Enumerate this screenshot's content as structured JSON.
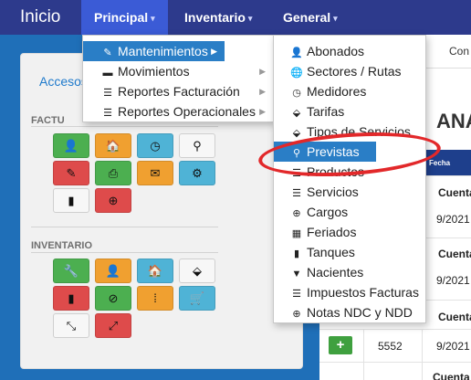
{
  "navbar": {
    "brand": "Inicio",
    "items": [
      {
        "label": "Principal",
        "active": true
      },
      {
        "label": "Inventario",
        "active": false
      },
      {
        "label": "General",
        "active": false
      }
    ],
    "caret": "▾"
  },
  "left_panel": {
    "link": "Accesos",
    "section1": "FACTU",
    "section2": "INVENTARIO",
    "tiles1": [
      {
        "icon": "user-icon",
        "glyph": "👤",
        "color": "green"
      },
      {
        "icon": "home-icon",
        "glyph": "🏠",
        "color": "orange"
      },
      {
        "icon": "clock-icon",
        "glyph": "◷",
        "color": "blue"
      },
      {
        "icon": "map-marker-icon",
        "glyph": "⚲",
        "color": "white"
      },
      {
        "icon": "pencil-icon",
        "glyph": "✎",
        "color": "red"
      },
      {
        "icon": "print-icon",
        "glyph": "⎙",
        "color": "green"
      },
      {
        "icon": "envelope-icon",
        "glyph": "✉",
        "color": "orange"
      },
      {
        "icon": "gear-icon",
        "glyph": "⚙",
        "color": "blue"
      },
      {
        "icon": "file-icon",
        "glyph": "▮",
        "color": "white"
      },
      {
        "icon": "plus-circle-icon",
        "glyph": "⊕",
        "color": "red"
      }
    ],
    "tiles2": [
      {
        "icon": "wrench-icon",
        "glyph": "🔧",
        "color": "green"
      },
      {
        "icon": "user-icon",
        "glyph": "👤",
        "color": "orange"
      },
      {
        "icon": "home-icon",
        "glyph": "🏠",
        "color": "blue"
      },
      {
        "icon": "tag-icon",
        "glyph": "⬙",
        "color": "white"
      },
      {
        "icon": "bookmark-icon",
        "glyph": "▮",
        "color": "red"
      },
      {
        "icon": "check-circle-icon",
        "glyph": "⊘",
        "color": "green"
      },
      {
        "icon": "road-icon",
        "glyph": "⁞",
        "color": "orange"
      },
      {
        "icon": "cart-icon",
        "glyph": "🛒",
        "color": "blue"
      },
      {
        "icon": "compress-icon",
        "glyph": "⤡",
        "color": "white"
      },
      {
        "icon": "expand-icon",
        "glyph": "⤢",
        "color": "red"
      }
    ]
  },
  "principal_menu": [
    {
      "label": "Mantenimientos",
      "icon": "✎",
      "selected": true,
      "has_sub": true
    },
    {
      "label": "Movimientos",
      "icon": "▬",
      "selected": false,
      "has_sub": true
    },
    {
      "label": "Reportes Facturación",
      "icon": "☰",
      "selected": false,
      "has_sub": true
    },
    {
      "label": "Reportes Operacionales",
      "icon": "☰",
      "selected": false,
      "has_sub": true
    }
  ],
  "submenu": [
    {
      "label": "Abonados",
      "icon": "👤",
      "selected": false
    },
    {
      "label": "Sectores / Rutas",
      "icon": "🌐",
      "selected": false
    },
    {
      "label": "Medidores",
      "icon": "◷",
      "selected": false
    },
    {
      "label": "Tarifas",
      "icon": "⬙",
      "selected": false
    },
    {
      "label": "Tipos de Servicios",
      "icon": "⬙",
      "selected": false
    },
    {
      "label": "Previstas",
      "icon": "⚲",
      "selected": true
    },
    {
      "label": "Productos",
      "icon": "☰",
      "selected": false
    },
    {
      "label": "Servicios",
      "icon": "☰",
      "selected": false
    },
    {
      "label": "Cargos",
      "icon": "⊕",
      "selected": false
    },
    {
      "label": "Feriados",
      "icon": "▦",
      "selected": false
    },
    {
      "label": "Tanques",
      "icon": "▮",
      "selected": false
    },
    {
      "label": "Nacientes",
      "icon": "▼",
      "selected": false
    },
    {
      "label": "Impuestos Facturas",
      "icon": "☰",
      "selected": false
    },
    {
      "label": "Notas NDC y NDD",
      "icon": "⊕",
      "selected": false
    }
  ],
  "content": {
    "tab": "Con",
    "heading": "ANA",
    "header_col": "Fecha",
    "rows": [
      {
        "label": "Cuenta",
        "date": "9/2021"
      },
      {
        "label": "Cuenta",
        "date": "9/2021"
      },
      {
        "label": "Cuenta",
        "date": "9/2021"
      },
      {
        "number": "5552",
        "date": "9/2021"
      },
      {
        "label": "Cuenta"
      }
    ],
    "add_button": "+"
  }
}
